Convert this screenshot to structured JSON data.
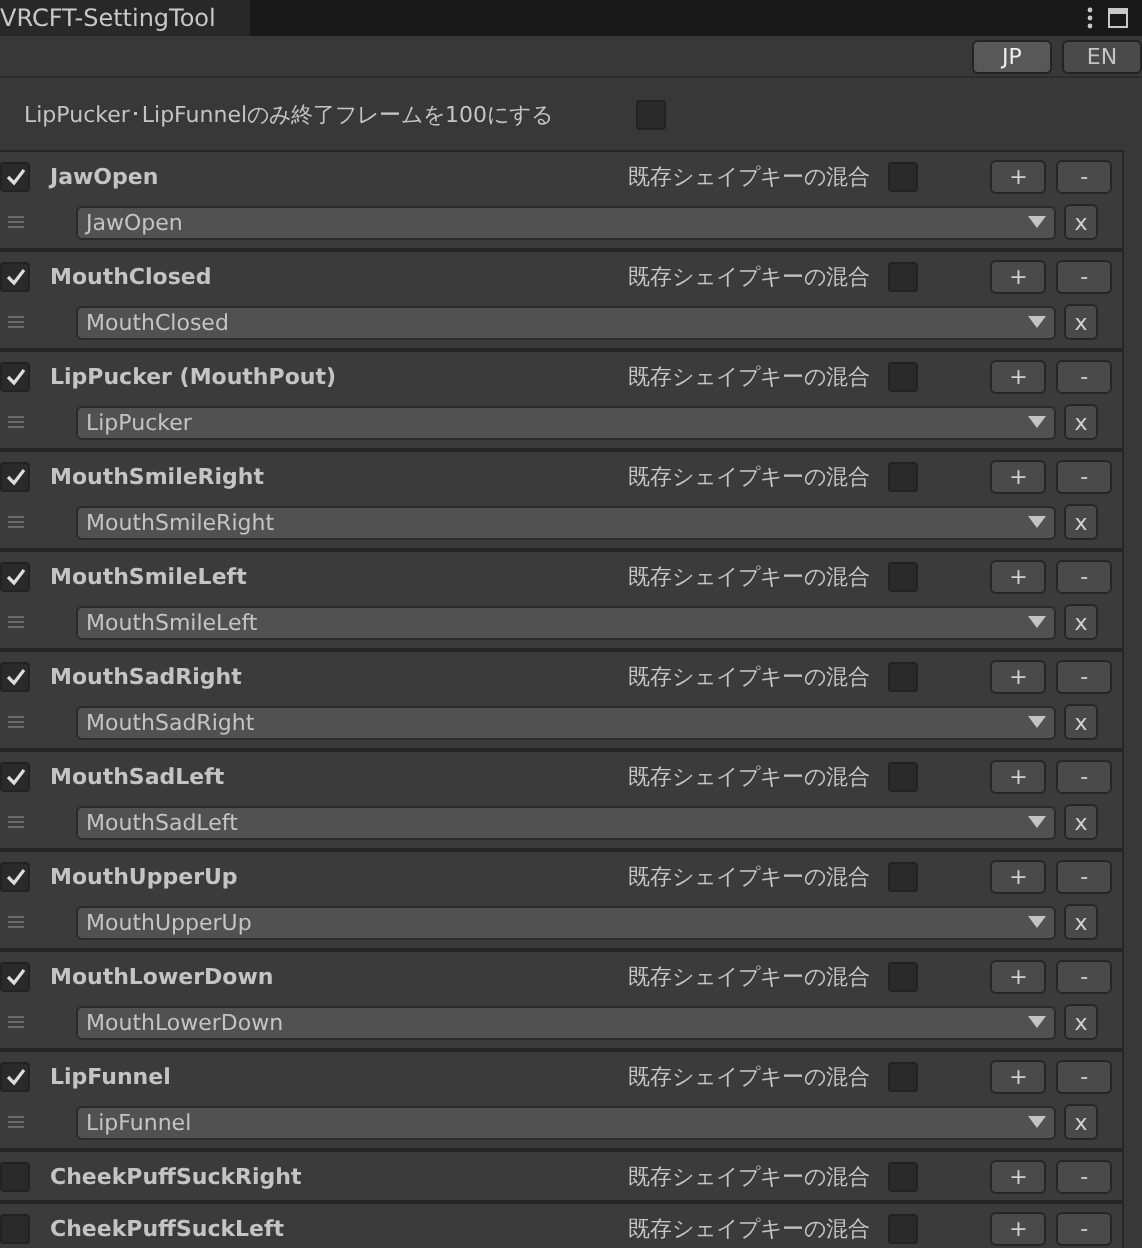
{
  "window": {
    "title": "VRCFT-SettingTool"
  },
  "languages": [
    {
      "label": "JP",
      "selected": true
    },
    {
      "label": "EN",
      "selected": false
    }
  ],
  "option": {
    "label": "LipPucker･LipFunnelのみ終了フレームを100にする",
    "checked": false
  },
  "items": [
    {
      "name": "JawOpen",
      "enabled": true,
      "mix_label": "既存シェイプキーの混合",
      "mix": false,
      "add": "+",
      "remove": "-",
      "shape": {
        "value": "JawOpen",
        "clear": "x"
      }
    },
    {
      "name": "MouthClosed",
      "enabled": true,
      "mix_label": "既存シェイプキーの混合",
      "mix": false,
      "add": "+",
      "remove": "-",
      "shape": {
        "value": "MouthClosed",
        "clear": "x"
      }
    },
    {
      "name": "LipPucker (MouthPout)",
      "enabled": true,
      "mix_label": "既存シェイプキーの混合",
      "mix": false,
      "add": "+",
      "remove": "-",
      "shape": {
        "value": "LipPucker",
        "clear": "x"
      }
    },
    {
      "name": "MouthSmileRight",
      "enabled": true,
      "mix_label": "既存シェイプキーの混合",
      "mix": false,
      "add": "+",
      "remove": "-",
      "shape": {
        "value": "MouthSmileRight",
        "clear": "x"
      }
    },
    {
      "name": "MouthSmileLeft",
      "enabled": true,
      "mix_label": "既存シェイプキーの混合",
      "mix": false,
      "add": "+",
      "remove": "-",
      "shape": {
        "value": "MouthSmileLeft",
        "clear": "x"
      }
    },
    {
      "name": "MouthSadRight",
      "enabled": true,
      "mix_label": "既存シェイプキーの混合",
      "mix": false,
      "add": "+",
      "remove": "-",
      "shape": {
        "value": "MouthSadRight",
        "clear": "x"
      }
    },
    {
      "name": "MouthSadLeft",
      "enabled": true,
      "mix_label": "既存シェイプキーの混合",
      "mix": false,
      "add": "+",
      "remove": "-",
      "shape": {
        "value": "MouthSadLeft",
        "clear": "x"
      }
    },
    {
      "name": "MouthUpperUp",
      "enabled": true,
      "mix_label": "既存シェイプキーの混合",
      "mix": false,
      "add": "+",
      "remove": "-",
      "shape": {
        "value": "MouthUpperUp",
        "clear": "x"
      }
    },
    {
      "name": "MouthLowerDown",
      "enabled": true,
      "mix_label": "既存シェイプキーの混合",
      "mix": false,
      "add": "+",
      "remove": "-",
      "shape": {
        "value": "MouthLowerDown",
        "clear": "x"
      }
    },
    {
      "name": "LipFunnel",
      "enabled": true,
      "mix_label": "既存シェイプキーの混合",
      "mix": false,
      "add": "+",
      "remove": "-",
      "shape": {
        "value": "LipFunnel",
        "clear": "x"
      }
    },
    {
      "name": "CheekPuffSuckRight",
      "enabled": false,
      "mix_label": "既存シェイプキーの混合",
      "mix": false,
      "add": "+",
      "remove": "-"
    },
    {
      "name": "CheekPuffSuckLeft",
      "enabled": false,
      "mix_label": "既存シェイプキーの混合",
      "mix": false,
      "add": "+",
      "remove": "-"
    }
  ]
}
